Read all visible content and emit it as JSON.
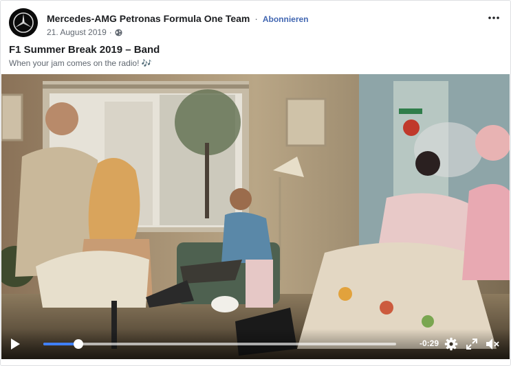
{
  "post": {
    "page_name": "Mercedes-AMG Petronas Formula One Team",
    "separator": "·",
    "follow_label": "Abonnieren",
    "date": "21. August 2019",
    "date_separator": "·",
    "privacy_icon": "globe-icon",
    "options_icon": "more-options-icon",
    "title": "F1 Summer Break 2019 – Band",
    "caption": "When your jam comes on the radio! 🎶"
  },
  "video": {
    "progress": 0.1,
    "remaining_time": "-0:29",
    "controls": {
      "play_icon": "play-icon",
      "settings_icon": "settings-icon",
      "fullscreen_icon": "fullscreen-icon",
      "mute_icon": "volume-muted-icon"
    }
  },
  "colors": {
    "accent": "#4267b2",
    "progress": "#4080ff",
    "text_secondary": "#606770"
  }
}
